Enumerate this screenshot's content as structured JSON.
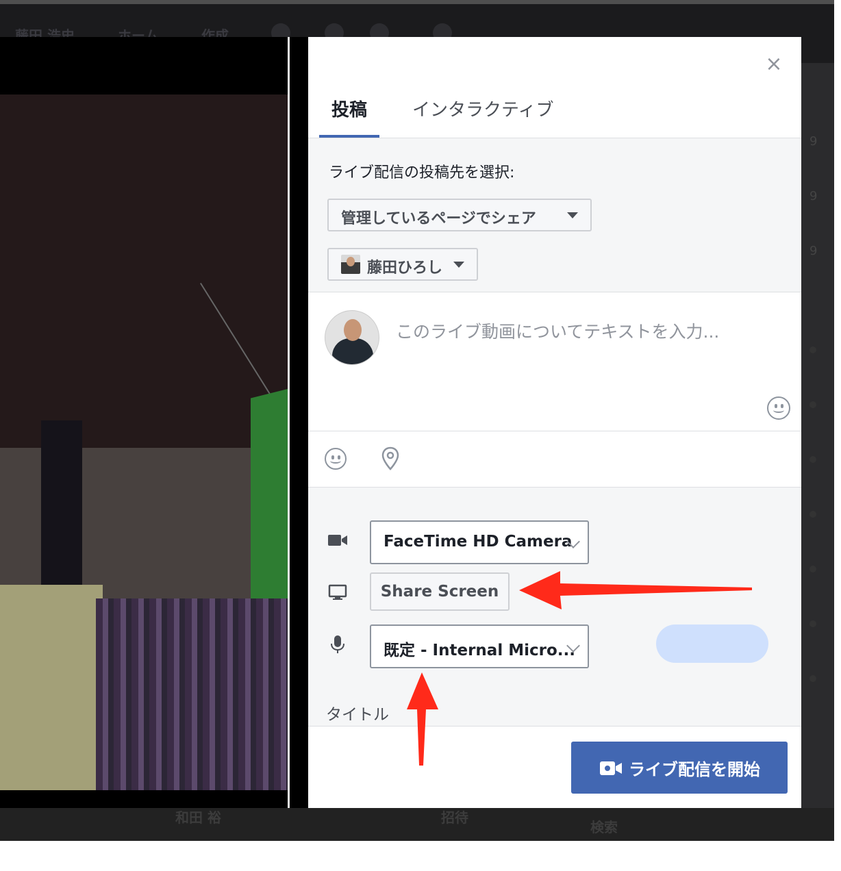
{
  "background": {
    "bar_items": [
      "藤田 浩史",
      "ホーム",
      "作成"
    ],
    "bottom_items": [
      "和田 裕",
      "招待",
      "検索"
    ],
    "right_counts": [
      "9",
      "9",
      "9"
    ]
  },
  "dialog": {
    "close_glyph": "×",
    "tabs": [
      {
        "label": "投稿",
        "active": true
      },
      {
        "label": "インタラクティブ",
        "active": false
      }
    ],
    "destination_label": "ライブ配信の投稿先を選択:",
    "share_dropdown": "管理しているページでシェア",
    "person_dropdown": "藤田ひろし",
    "composer_placeholder": "このライブ動画についてテキストを入力...",
    "camera_select": "FaceTime HD Camera",
    "share_screen_label": "Share Screen",
    "mic_select": "既定 - Internal Micro...",
    "title_label": "タイトル",
    "go_live_label": "ライブ配信を開始"
  },
  "colors": {
    "accent": "#4267b2",
    "annotation_arrow": "#ff2a1a",
    "audio_meter": "#cfe0fd"
  },
  "icons": [
    "close-icon",
    "smile-icon",
    "location-pin-icon",
    "video-camera-icon",
    "monitor-icon",
    "microphone-icon",
    "live-camera-icon"
  ]
}
